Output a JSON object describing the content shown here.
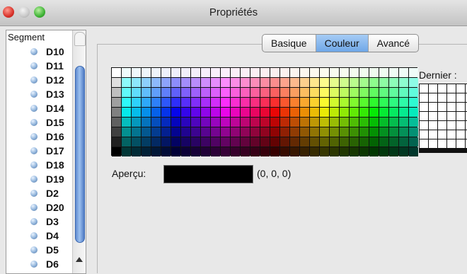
{
  "window": {
    "title": "Propriétés"
  },
  "sidebar": {
    "title": "Segment",
    "items": [
      {
        "label": "D10"
      },
      {
        "label": "D11"
      },
      {
        "label": "D12"
      },
      {
        "label": "D13"
      },
      {
        "label": "D14"
      },
      {
        "label": "D15"
      },
      {
        "label": "D16"
      },
      {
        "label": "D17"
      },
      {
        "label": "D18"
      },
      {
        "label": "D19"
      },
      {
        "label": "D2"
      },
      {
        "label": "D20"
      },
      {
        "label": "D3"
      },
      {
        "label": "D4"
      },
      {
        "label": "D5"
      },
      {
        "label": "D6"
      }
    ]
  },
  "tabs": [
    {
      "label": "Basique",
      "active": false
    },
    {
      "label": "Couleur",
      "active": true
    },
    {
      "label": "Avancé",
      "active": false
    }
  ],
  "palette": {
    "rows": 9,
    "columns": 31,
    "recent_label": "Dernier :",
    "recent_rows": 7,
    "recent_columns": 6
  },
  "preview": {
    "label": "Aperçu:",
    "color": "#000000",
    "value": "(0, 0, 0)"
  },
  "colors": {
    "window_bg": "#e8e8e8",
    "accent_tab": "#7aaeea",
    "close": "#d8322a",
    "maximize": "#3fb336"
  }
}
